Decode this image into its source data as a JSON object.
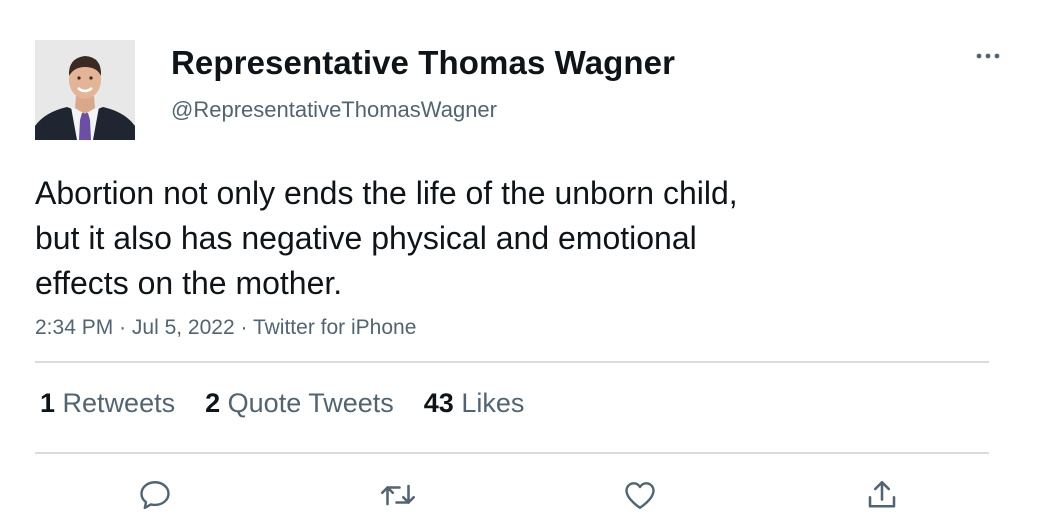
{
  "tweet": {
    "author": {
      "display_name": "Representative Thomas Wagner",
      "handle": "@RepresentativeThomasWagner"
    },
    "text_lines": [
      "Abortion not only ends the life of the unborn child,",
      "but it also has negative physical and emotional",
      "effects on the mother."
    ],
    "time": "2:34 PM",
    "separator": "·",
    "date": "Jul 5, 2022",
    "source": "Twitter for iPhone"
  },
  "stats": {
    "retweets": {
      "count": "1",
      "label": "Retweets"
    },
    "quote_tweets": {
      "count": "2",
      "label": "Quote Tweets"
    },
    "likes": {
      "count": "43",
      "label": "Likes"
    }
  },
  "actions": {
    "reply_icon": "comment-icon",
    "retweet_icon": "retweet-icon",
    "like_icon": "heart-icon",
    "share_icon": "share-icon"
  },
  "colors": {
    "text_primary": "#0f1419",
    "text_secondary": "#536471",
    "divider": "#d9dcdf"
  }
}
